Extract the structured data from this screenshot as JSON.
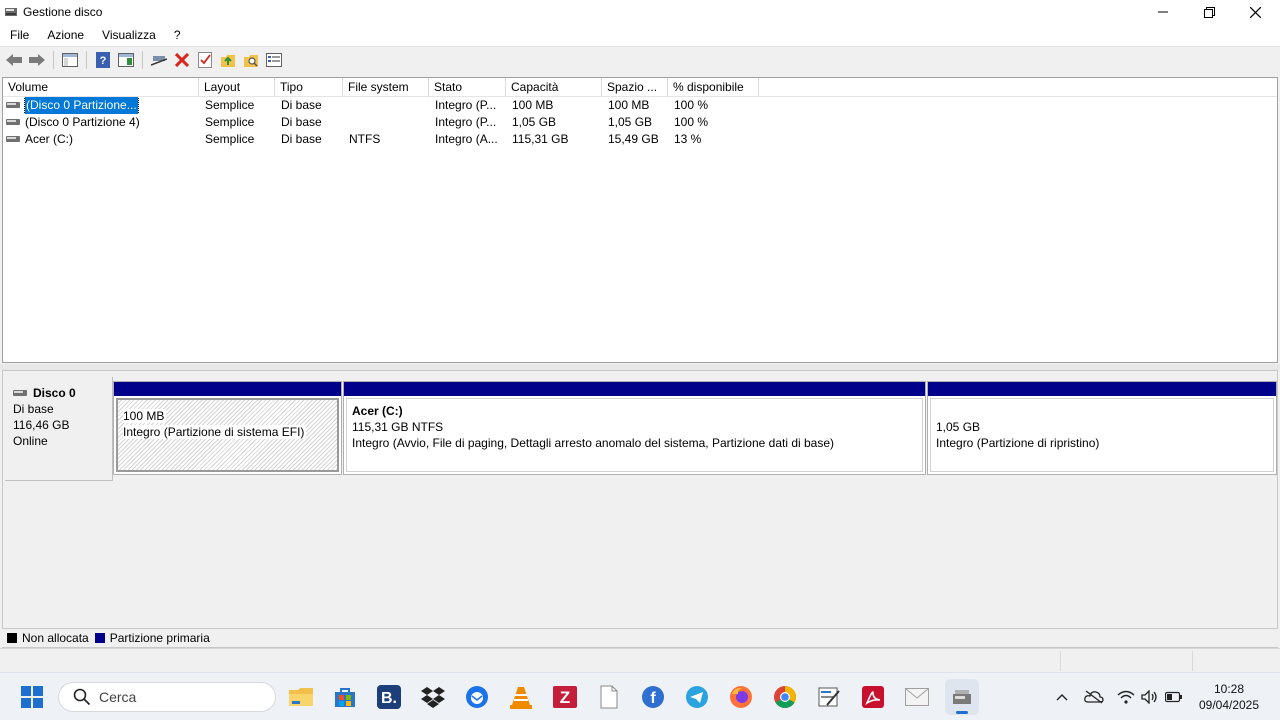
{
  "window": {
    "title": "Gestione disco"
  },
  "menu": [
    "File",
    "Azione",
    "Visualizza",
    "?"
  ],
  "toolbar": [
    "back-arrow-icon",
    "forward-arrow-icon",
    "console-tree-icon",
    "help-icon",
    "properties-pane-icon",
    "connect-drive-icon",
    "delete-icon",
    "checkmark-icon",
    "folder-up-icon",
    "folder-search-icon",
    "properties-icon"
  ],
  "volumes": {
    "columns": [
      "Volume",
      "Layout",
      "Tipo",
      "File system",
      "Stato",
      "Capacità",
      "Spazio ...",
      "% disponibile"
    ],
    "rows": [
      {
        "volume": "(Disco 0 Partizione...",
        "layout": "Semplice",
        "tipo": "Di base",
        "fs": "",
        "stato": "Integro (P...",
        "capacita": "100 MB",
        "spazio": "100 MB",
        "perc": "100 %"
      },
      {
        "volume": "(Disco 0 Partizione 4)",
        "layout": "Semplice",
        "tipo": "Di base",
        "fs": "",
        "stato": "Integro (P...",
        "capacita": "1,05 GB",
        "spazio": "1,05 GB",
        "perc": "100 %"
      },
      {
        "volume": "Acer (C:)",
        "layout": "Semplice",
        "tipo": "Di base",
        "fs": "NTFS",
        "stato": "Integro (A...",
        "capacita": "115,31 GB",
        "spazio": "15,49 GB",
        "perc": "13 %"
      }
    ]
  },
  "disk": {
    "name": "Disco 0",
    "type": "Di base",
    "size": "116,46 GB",
    "status": "Online",
    "partitions": [
      {
        "title": "",
        "size": "100 MB",
        "status": "Integro (Partizione di sistema EFI)"
      },
      {
        "title": "Acer  (C:)",
        "size": "115,31 GB NTFS",
        "status": "Integro (Avvio, File di paging, Dettagli arresto anomalo del sistema, Partizione dati di base)"
      },
      {
        "title": "",
        "size": "1,05 GB",
        "status": "Integro (Partizione di ripristino)"
      }
    ]
  },
  "legend": [
    {
      "label": "Non allocata",
      "color": "#000000"
    },
    {
      "label": "Partizione primaria",
      "color": "#00008b"
    }
  ],
  "taskbar": {
    "search_placeholder": "Cerca",
    "time": "10:28",
    "date": "09/04/2025"
  }
}
